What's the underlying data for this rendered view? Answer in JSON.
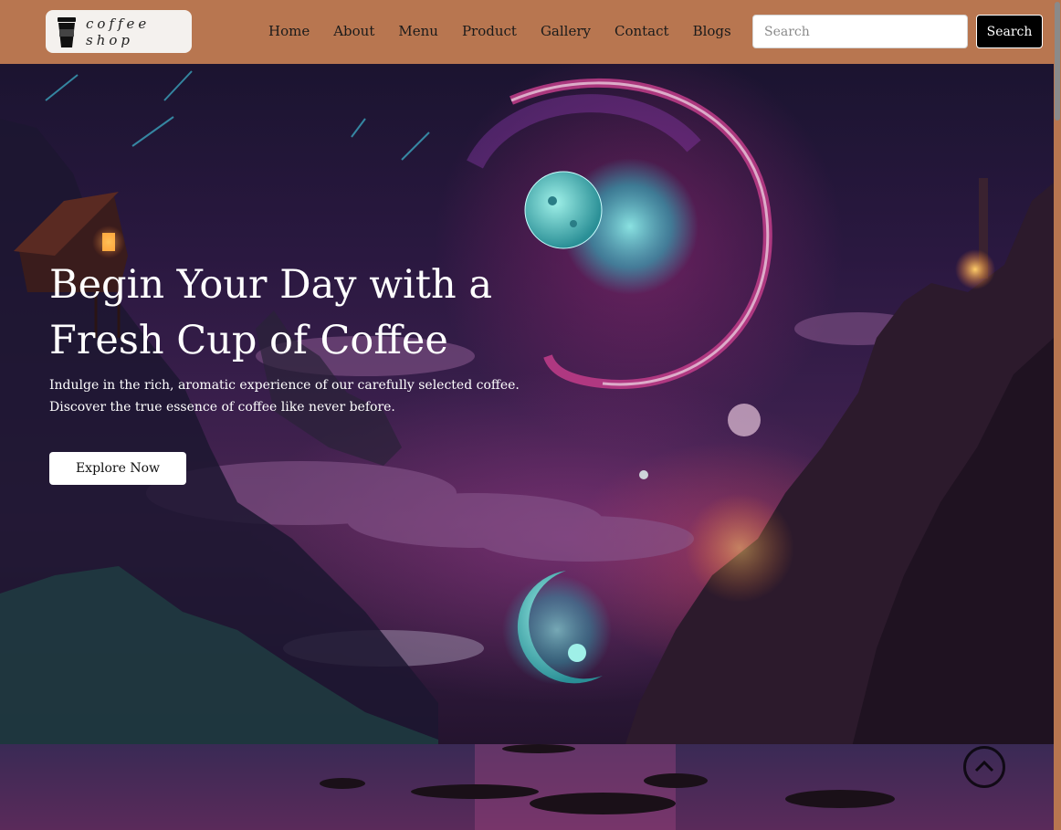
{
  "brand": {
    "logo_text": "coffee shop",
    "logo_icon": "coffee-cup-icon"
  },
  "nav": {
    "links": [
      {
        "label": "Home"
      },
      {
        "label": "About"
      },
      {
        "label": "Menu"
      },
      {
        "label": "Product"
      },
      {
        "label": "Gallery"
      },
      {
        "label": "Contact"
      },
      {
        "label": "Blogs"
      }
    ]
  },
  "search": {
    "placeholder": "Search",
    "value": "",
    "button_label": "Search"
  },
  "hero": {
    "title": "Begin Your Day with a Fresh Cup of Coffee",
    "subtitle": "Indulge in the rich, aromatic experience of our carefully selected coffee. Discover the true essence of coffee like never before.",
    "cta_label": "Explore Now"
  },
  "scroll_top": {
    "icon": "chevron-up-circle-icon"
  },
  "colors": {
    "navbar_bg": "#b87650",
    "search_button_bg": "#000000",
    "hero_text": "#ffffff",
    "cta_bg": "#ffffff"
  }
}
